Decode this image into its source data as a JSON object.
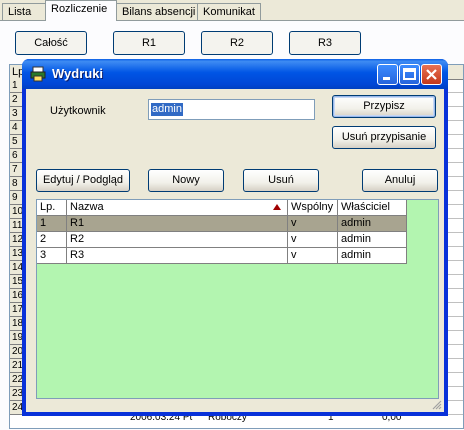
{
  "tabs": [
    {
      "label": "Lista"
    },
    {
      "label": "Rozliczenie"
    },
    {
      "label": "Bilans absencji"
    },
    {
      "label": "Komunikat"
    }
  ],
  "bg_buttons": {
    "all": "Całość",
    "r1": "R1",
    "r2": "R2",
    "r3": "R3"
  },
  "bg_grid": {
    "header_lp": "Lp",
    "row_numbers": [
      "1",
      "2",
      "3",
      "4",
      "5",
      "6",
      "7",
      "8",
      "9",
      "10",
      "11",
      "12",
      "13",
      "14",
      "15",
      "16",
      "17",
      "18",
      "19",
      "20",
      "21",
      "22",
      "23",
      "24"
    ],
    "peek_cells": [
      "2006.03.24 Pt",
      "Roboczy",
      "1",
      "0,00"
    ]
  },
  "dialog": {
    "title": "Wydruki",
    "user_label": "Użytkownik",
    "user_value": "admin",
    "assign_button": "Przypisz",
    "unassign_button": "Usuń przypisanie",
    "edit_button": "Edytuj / Podgląd",
    "new_button": "Nowy",
    "delete_button": "Usuń",
    "cancel_button": "Anuluj",
    "columns": [
      "Lp.",
      "Nazwa",
      "Wspólny",
      "Właściciel"
    ],
    "rows": [
      {
        "lp": "1",
        "nazwa": "R1",
        "wspolny": "v",
        "wlasciciel": "admin"
      },
      {
        "lp": "2",
        "nazwa": "R2",
        "wspolny": "v",
        "wlasciciel": "admin"
      },
      {
        "lp": "3",
        "nazwa": "R3",
        "wspolny": "v",
        "wlasciciel": "admin"
      }
    ]
  },
  "colors": {
    "list_background": "#b3f5b0",
    "selected_row": "#a8a490",
    "title_bar": "#0055e5"
  }
}
